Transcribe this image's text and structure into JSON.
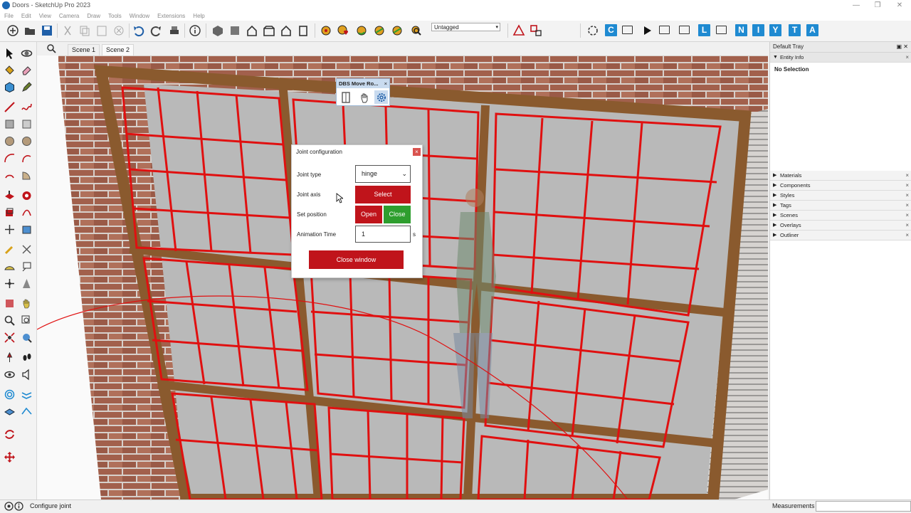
{
  "window": {
    "title": "Doors - SketchUp Pro 2023",
    "min": "—",
    "restore": "❐",
    "close": "✕"
  },
  "menu": [
    "File",
    "Edit",
    "View",
    "Camera",
    "Draw",
    "Tools",
    "Window",
    "Extensions",
    "Help"
  ],
  "toolbar": {
    "tag_dropdown": "Untagged",
    "letters": [
      "C",
      "L",
      "N",
      "I",
      "Y",
      "T",
      "A"
    ]
  },
  "scenes": [
    "Scene 1",
    "Scene 2"
  ],
  "tray": {
    "title": "Default Tray",
    "entity_info": {
      "label": "Entity Info",
      "value": "No Selection"
    },
    "panels": [
      "Materials",
      "Components",
      "Styles",
      "Tags",
      "Scenes",
      "Overlays",
      "Outliner"
    ]
  },
  "dbs_toolbar": {
    "title": "DBS Move Ro..."
  },
  "dialog": {
    "title": "Joint configuration",
    "joint_type_label": "Joint type",
    "joint_type_value": "hinge",
    "joint_axis_label": "Joint axis",
    "select_label": "Select",
    "set_position_label": "Set position",
    "open_label": "Open",
    "close_label": "Close",
    "animation_time_label": "Animation Time",
    "animation_time_value": "1",
    "unit": "s",
    "close_window_label": "Close window"
  },
  "status": {
    "text": "Configure joint",
    "measurements_label": "Measurements"
  },
  "colors": {
    "accent_red": "#c0141b",
    "accent_green": "#2e9e2e",
    "letter_blue": "#1f8ad1"
  }
}
